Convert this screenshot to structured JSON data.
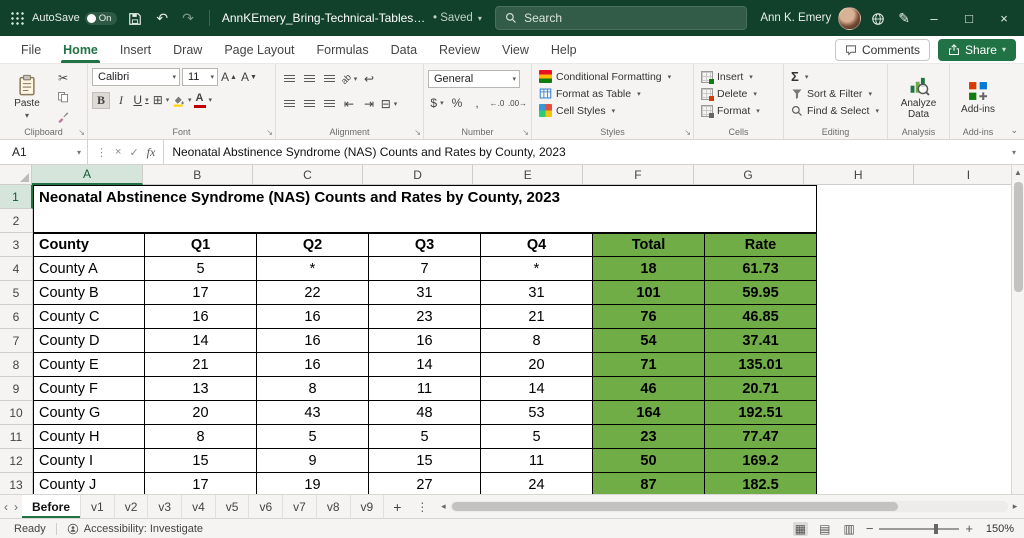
{
  "titlebar": {
    "autosave_label": "AutoSave",
    "autosave_state": "On",
    "doc_title": "AnnKEmery_Bring-Technical-Tables-t…",
    "saved_status": "• Saved",
    "search_placeholder": "Search",
    "user_name": "Ann K. Emery"
  },
  "menubar": {
    "tabs": [
      "File",
      "Home",
      "Insert",
      "Draw",
      "Page Layout",
      "Formulas",
      "Data",
      "Review",
      "View",
      "Help"
    ],
    "active_tab": "Home",
    "comments_label": "Comments",
    "share_label": "Share"
  },
  "ribbon": {
    "groups": {
      "clipboard": {
        "label": "Clipboard",
        "paste": "Paste"
      },
      "font": {
        "label": "Font",
        "font_name": "Calibri",
        "font_size": "11"
      },
      "alignment": {
        "label": "Alignment"
      },
      "number": {
        "label": "Number",
        "format": "General"
      },
      "styles": {
        "label": "Styles",
        "conditional": "Conditional Formatting",
        "format_table": "Format as Table",
        "cell_styles": "Cell Styles"
      },
      "cells": {
        "label": "Cells",
        "insert": "Insert",
        "delete": "Delete",
        "format": "Format"
      },
      "editing": {
        "label": "Editing",
        "sort_filter": "Sort & Filter",
        "find_select": "Find & Select"
      },
      "analysis": {
        "label": "Analysis",
        "button": "Analyze Data"
      },
      "addins": {
        "label": "Add-ins",
        "button": "Add-ins"
      }
    }
  },
  "formula_bar": {
    "name_box": "A1",
    "fx_label": "fx",
    "content": "Neonatal Abstinence Syndrome (NAS) Counts and Rates by County, 2023"
  },
  "sheet": {
    "col_headers": [
      "A",
      "B",
      "C",
      "D",
      "E",
      "F",
      "G",
      "H",
      "I"
    ],
    "selected_col": "A",
    "selected_row": "1",
    "visible_rows": 13,
    "title": "Neonatal Abstinence Syndrome (NAS) Counts and Rates by County, 2023",
    "table_header": [
      "County",
      "Q1",
      "Q2",
      "Q3",
      "Q4",
      "Total",
      "Rate"
    ],
    "rows": [
      [
        "County A",
        "5",
        "*",
        "7",
        "*",
        "18",
        "61.73"
      ],
      [
        "County B",
        "17",
        "22",
        "31",
        "31",
        "101",
        "59.95"
      ],
      [
        "County C",
        "16",
        "16",
        "23",
        "21",
        "76",
        "46.85"
      ],
      [
        "County D",
        "14",
        "16",
        "16",
        "8",
        "54",
        "37.41"
      ],
      [
        "County E",
        "21",
        "16",
        "14",
        "20",
        "71",
        "135.01"
      ],
      [
        "County F",
        "13",
        "8",
        "11",
        "14",
        "46",
        "20.71"
      ],
      [
        "County G",
        "20",
        "43",
        "48",
        "53",
        "164",
        "192.51"
      ],
      [
        "County H",
        "8",
        "5",
        "5",
        "5",
        "23",
        "77.47"
      ],
      [
        "County I",
        "15",
        "9",
        "15",
        "11",
        "50",
        "169.2"
      ],
      [
        "County J",
        "17",
        "19",
        "27",
        "24",
        "87",
        "182.5"
      ]
    ],
    "accent_green": "#70AD47"
  },
  "sheet_tabs": {
    "tabs": [
      "Before",
      "v1",
      "v2",
      "v3",
      "v4",
      "v5",
      "v6",
      "v7",
      "v8",
      "v9"
    ],
    "active": "Before",
    "add_label": "+"
  },
  "status_bar": {
    "ready": "Ready",
    "accessibility": "Accessibility: Investigate",
    "zoom_level": "150%"
  }
}
